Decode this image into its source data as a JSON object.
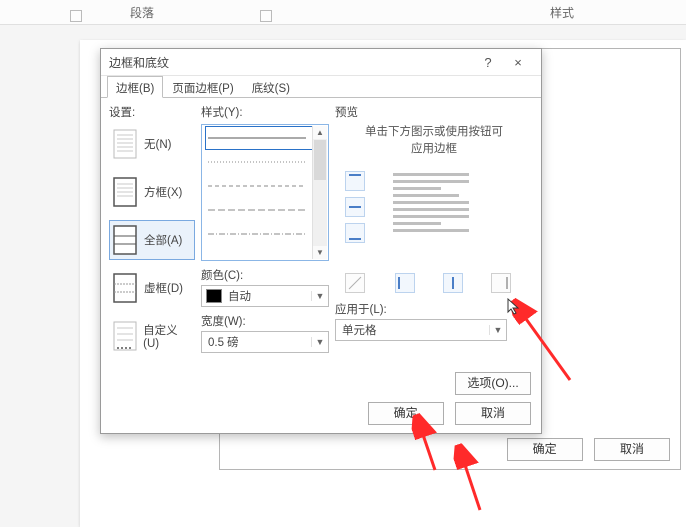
{
  "ribbon": {
    "group_paragraph": "段落",
    "group_styles": "样式"
  },
  "parent_dialog": {
    "ok": "确定",
    "cancel": "取消"
  },
  "dialog": {
    "title": "边框和底纹",
    "help": "?",
    "close": "×",
    "tabs": {
      "borders": "边框(B)",
      "page_border": "页面边框(P)",
      "shading": "底纹(S)"
    },
    "setting": {
      "label": "设置:",
      "none": "无(N)",
      "box": "方框(X)",
      "all": "全部(A)",
      "grid": "虚框(D)",
      "custom": "自定义(U)"
    },
    "style": {
      "label": "样式(Y):"
    },
    "color": {
      "label": "颜色(C):",
      "value": "自动"
    },
    "width": {
      "label": "宽度(W):",
      "value": "0.5 磅"
    },
    "preview": {
      "label": "预览",
      "hint1": "单击下方图示或使用按钮可",
      "hint2": "应用边框"
    },
    "apply_to": {
      "label": "应用于(L):",
      "value": "单元格"
    },
    "options": "选项(O)...",
    "ok": "确定",
    "cancel": "取消"
  }
}
